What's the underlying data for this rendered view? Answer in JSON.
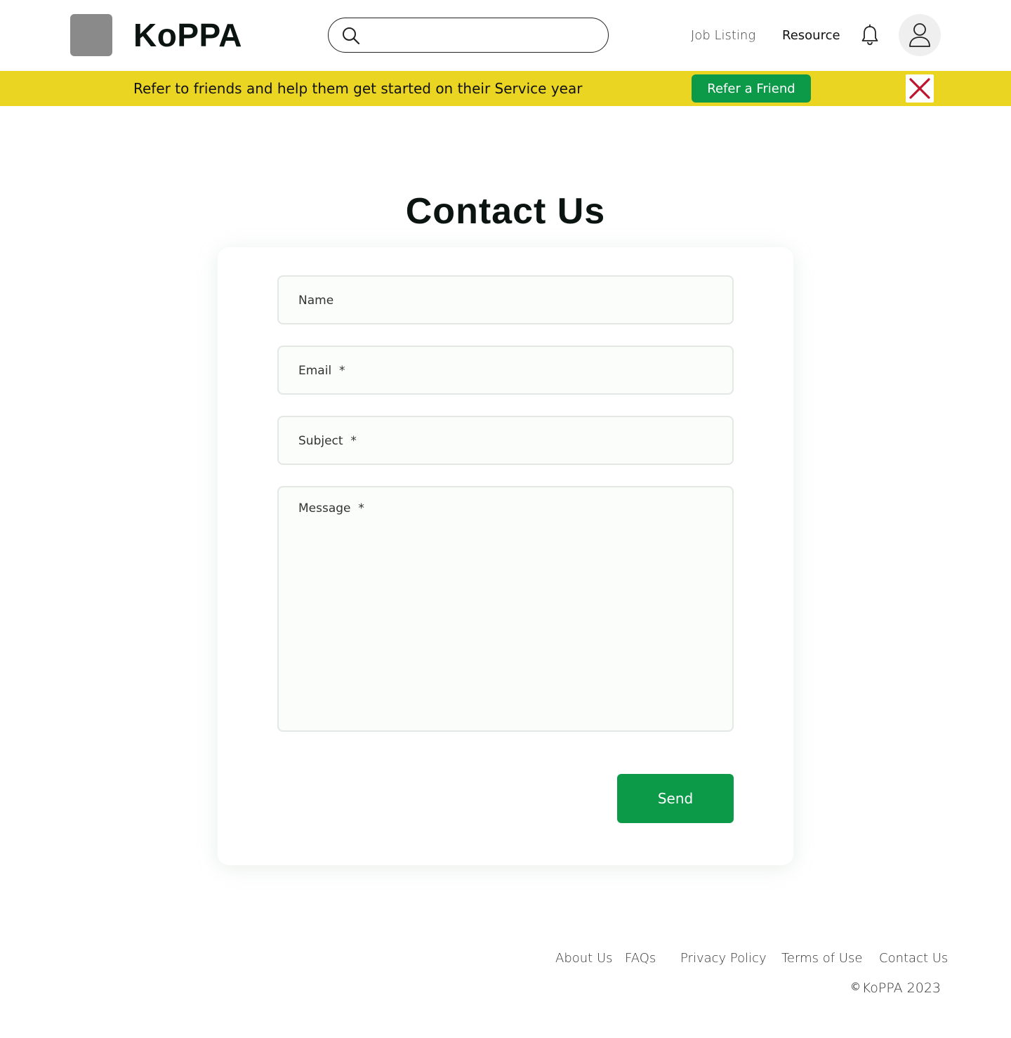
{
  "header": {
    "brand": "KoPPA",
    "search": {
      "placeholder": "",
      "value": ""
    },
    "nav": [
      {
        "label": "Job Listing"
      },
      {
        "label": "Resource"
      }
    ]
  },
  "banner": {
    "text": "Refer to friends and help them get started on their Service year",
    "button_label": "Refer a Friend",
    "color": "#ebd523",
    "button_color": "#0c9a48",
    "close_color": "#c0132f"
  },
  "main": {
    "title": "Contact Us",
    "form": {
      "name_placeholder": "Name",
      "email_placeholder": "Email  *",
      "subject_placeholder": "Subject  *",
      "message_placeholder": "Message  *",
      "send_label": "Send"
    }
  },
  "footer": {
    "links": [
      {
        "label": "About Us"
      },
      {
        "label": "FAQs"
      },
      {
        "label": "Privacy Policy"
      },
      {
        "label": "Terms of Use"
      },
      {
        "label": "Contact Us"
      }
    ],
    "copyright_symbol": "©",
    "copyright": "KoPPA 2023"
  },
  "icons": [
    "logo-placeholder",
    "search-icon",
    "bell-icon",
    "user-icon",
    "close-icon"
  ]
}
